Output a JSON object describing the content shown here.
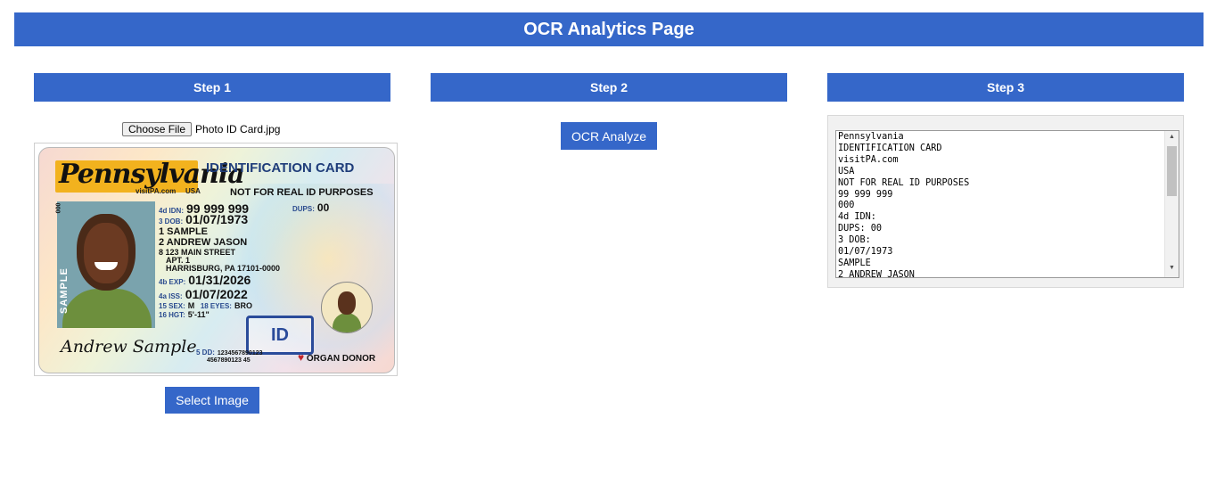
{
  "header": {
    "title": "OCR Analytics Page"
  },
  "steps": [
    {
      "label": "Step 1"
    },
    {
      "label": "Step 2"
    },
    {
      "label": "Step 3"
    }
  ],
  "step1": {
    "choose_file_label": "Choose File",
    "file_name": "Photo ID Card.jpg",
    "select_button_label": "Select Image",
    "card": {
      "state": "Pennsylvania",
      "website": "visitPA.com",
      "country": "USA",
      "card_type": "IDENTIFICATION CARD",
      "notice": "NOT FOR REAL ID PURPOSES",
      "side_number": "000",
      "idn_label": "4d IDN:",
      "idn": "99 999 999",
      "dups_label": "DUPS:",
      "dups": "00",
      "dob_label": "3 DOB:",
      "dob": "01/07/1973",
      "last_name": "1 SAMPLE",
      "first_name": "2 ANDREW JASON",
      "address1": "8 123 MAIN STREET",
      "address2": "APT. 1",
      "address3": "HARRISBURG, PA 17101-0000",
      "exp_label": "4b EXP:",
      "exp": "01/31/2026",
      "iss_label": "4a ISS:",
      "iss": "01/07/2022",
      "sex_label": "15 SEX:",
      "sex": "M",
      "eyes_label": "18 EYES:",
      "eyes": "BRO",
      "hgt_label": "16 HGT:",
      "hgt": "5'-11\"",
      "photo_label": "SAMPLE",
      "id_badge": "ID",
      "signature": "Andrew Sample",
      "dd_label": "5 DD:",
      "dd_line1": "1234567890123",
      "dd_line2": "4567890123 45",
      "donor": "ORGAN DONOR"
    }
  },
  "step2": {
    "analyze_button_label": "OCR Analyze"
  },
  "step3": {
    "ocr_result": "Pennsylvania\nIDENTIFICATION CARD\nvisitPA.com\nUSA\nNOT FOR REAL ID PURPOSES\n99 999 999\n000\n4d IDN:\nDUPS: 00\n3 DOB:\n01/07/1973\nSAMPLE\n2 ANDREW JASON"
  },
  "colors": {
    "accent": "#3567c9",
    "panel_bg": "#f1f1f1"
  },
  "icons": {
    "scroll_up": "scroll-up-icon",
    "scroll_down": "scroll-down-icon",
    "heart": "heart-icon"
  }
}
